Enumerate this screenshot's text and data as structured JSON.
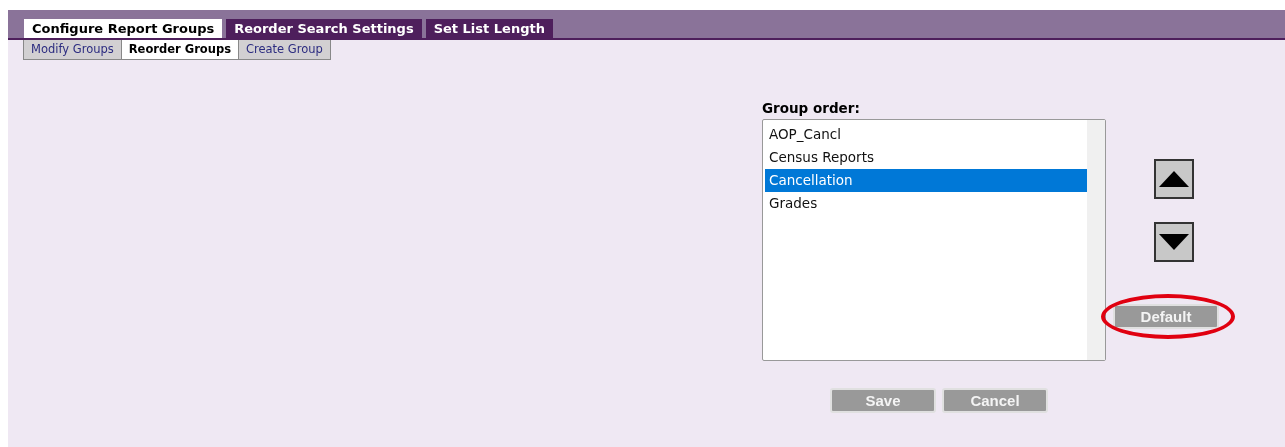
{
  "tabs": [
    {
      "label": "Configure Report Groups",
      "selected": true
    },
    {
      "label": "Reorder Search Settings",
      "selected": false
    },
    {
      "label": "Set List Length",
      "selected": false
    }
  ],
  "subtabs": [
    {
      "label": "Modify Groups",
      "selected": false
    },
    {
      "label": "Reorder Groups",
      "selected": true
    },
    {
      "label": "Create Group",
      "selected": false
    }
  ],
  "group_order": {
    "label": "Group order:",
    "items": [
      {
        "label": "AOP_Cancl",
        "selected": false
      },
      {
        "label": "Census Reports",
        "selected": false
      },
      {
        "label": "Cancellation",
        "selected": true
      },
      {
        "label": "Grades",
        "selected": false
      }
    ]
  },
  "default_button": {
    "label": "Default",
    "highlighted": true
  },
  "buttons": [
    "Save",
    "Cancel"
  ]
}
